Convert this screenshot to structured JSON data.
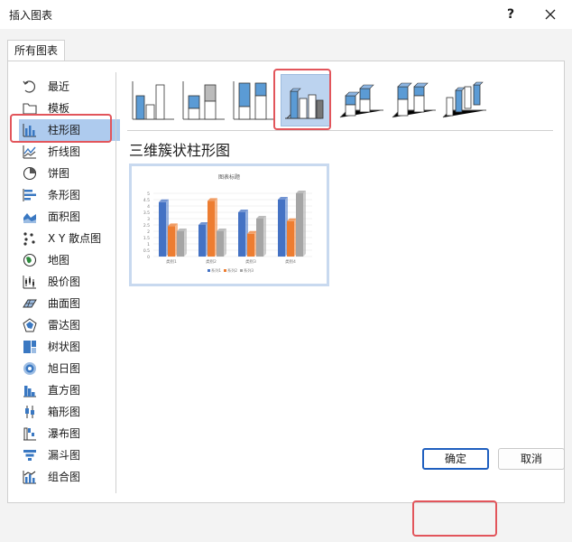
{
  "dialog": {
    "title": "插入图表",
    "help": "?"
  },
  "tab": {
    "label": "所有图表"
  },
  "sidebar": {
    "items": [
      {
        "label": "最近",
        "icon": "recent-icon"
      },
      {
        "label": "模板",
        "icon": "folder-icon"
      },
      {
        "label": "柱形图",
        "icon": "column-chart-icon",
        "selected": true
      },
      {
        "label": "折线图",
        "icon": "line-chart-icon"
      },
      {
        "label": "饼图",
        "icon": "pie-chart-icon"
      },
      {
        "label": "条形图",
        "icon": "bar-chart-icon"
      },
      {
        "label": "面积图",
        "icon": "area-chart-icon"
      },
      {
        "label": "X Y 散点图",
        "icon": "scatter-chart-icon"
      },
      {
        "label": "地图",
        "icon": "map-chart-icon"
      },
      {
        "label": "股价图",
        "icon": "stock-chart-icon"
      },
      {
        "label": "曲面图",
        "icon": "surface-chart-icon"
      },
      {
        "label": "雷达图",
        "icon": "radar-chart-icon"
      },
      {
        "label": "树状图",
        "icon": "treemap-chart-icon"
      },
      {
        "label": "旭日图",
        "icon": "sunburst-chart-icon"
      },
      {
        "label": "直方图",
        "icon": "histogram-chart-icon"
      },
      {
        "label": "箱形图",
        "icon": "box-whisker-chart-icon"
      },
      {
        "label": "瀑布图",
        "icon": "waterfall-chart-icon"
      },
      {
        "label": "漏斗图",
        "icon": "funnel-chart-icon"
      },
      {
        "label": "组合图",
        "icon": "combo-chart-icon"
      }
    ]
  },
  "subtypes": [
    {
      "name": "clustered-column",
      "selected": false
    },
    {
      "name": "stacked-column",
      "selected": false
    },
    {
      "name": "100-stacked-column",
      "selected": false
    },
    {
      "name": "3d-clustered-column",
      "selected": true
    },
    {
      "name": "3d-stacked-column",
      "selected": false
    },
    {
      "name": "3d-100-stacked-column",
      "selected": false
    },
    {
      "name": "3d-column",
      "selected": false
    }
  ],
  "selected_type": {
    "title": "三维簇状柱形图"
  },
  "preview": {
    "chart_data": {
      "type": "bar",
      "title": "图表标题",
      "categories": [
        "类别1",
        "类别2",
        "类别3",
        "类别4"
      ],
      "series": [
        {
          "name": "系列1",
          "values": [
            4.3,
            2.5,
            3.5,
            4.5
          ]
        },
        {
          "name": "系列2",
          "values": [
            2.4,
            4.4,
            1.8,
            2.8
          ]
        },
        {
          "name": "系列3",
          "values": [
            2,
            2,
            3,
            5
          ]
        }
      ],
      "yticks": [
        "0",
        "0.5",
        "1",
        "1.5",
        "2",
        "2.5",
        "3",
        "3.5",
        "4",
        "4.5",
        "5"
      ],
      "ylim": [
        0,
        5
      ],
      "colors": [
        "#4472c4",
        "#ed7d31",
        "#a5a5a5"
      ],
      "legend": "bottom",
      "grid": true
    }
  },
  "buttons": {
    "ok": "确定",
    "cancel": "取消"
  }
}
